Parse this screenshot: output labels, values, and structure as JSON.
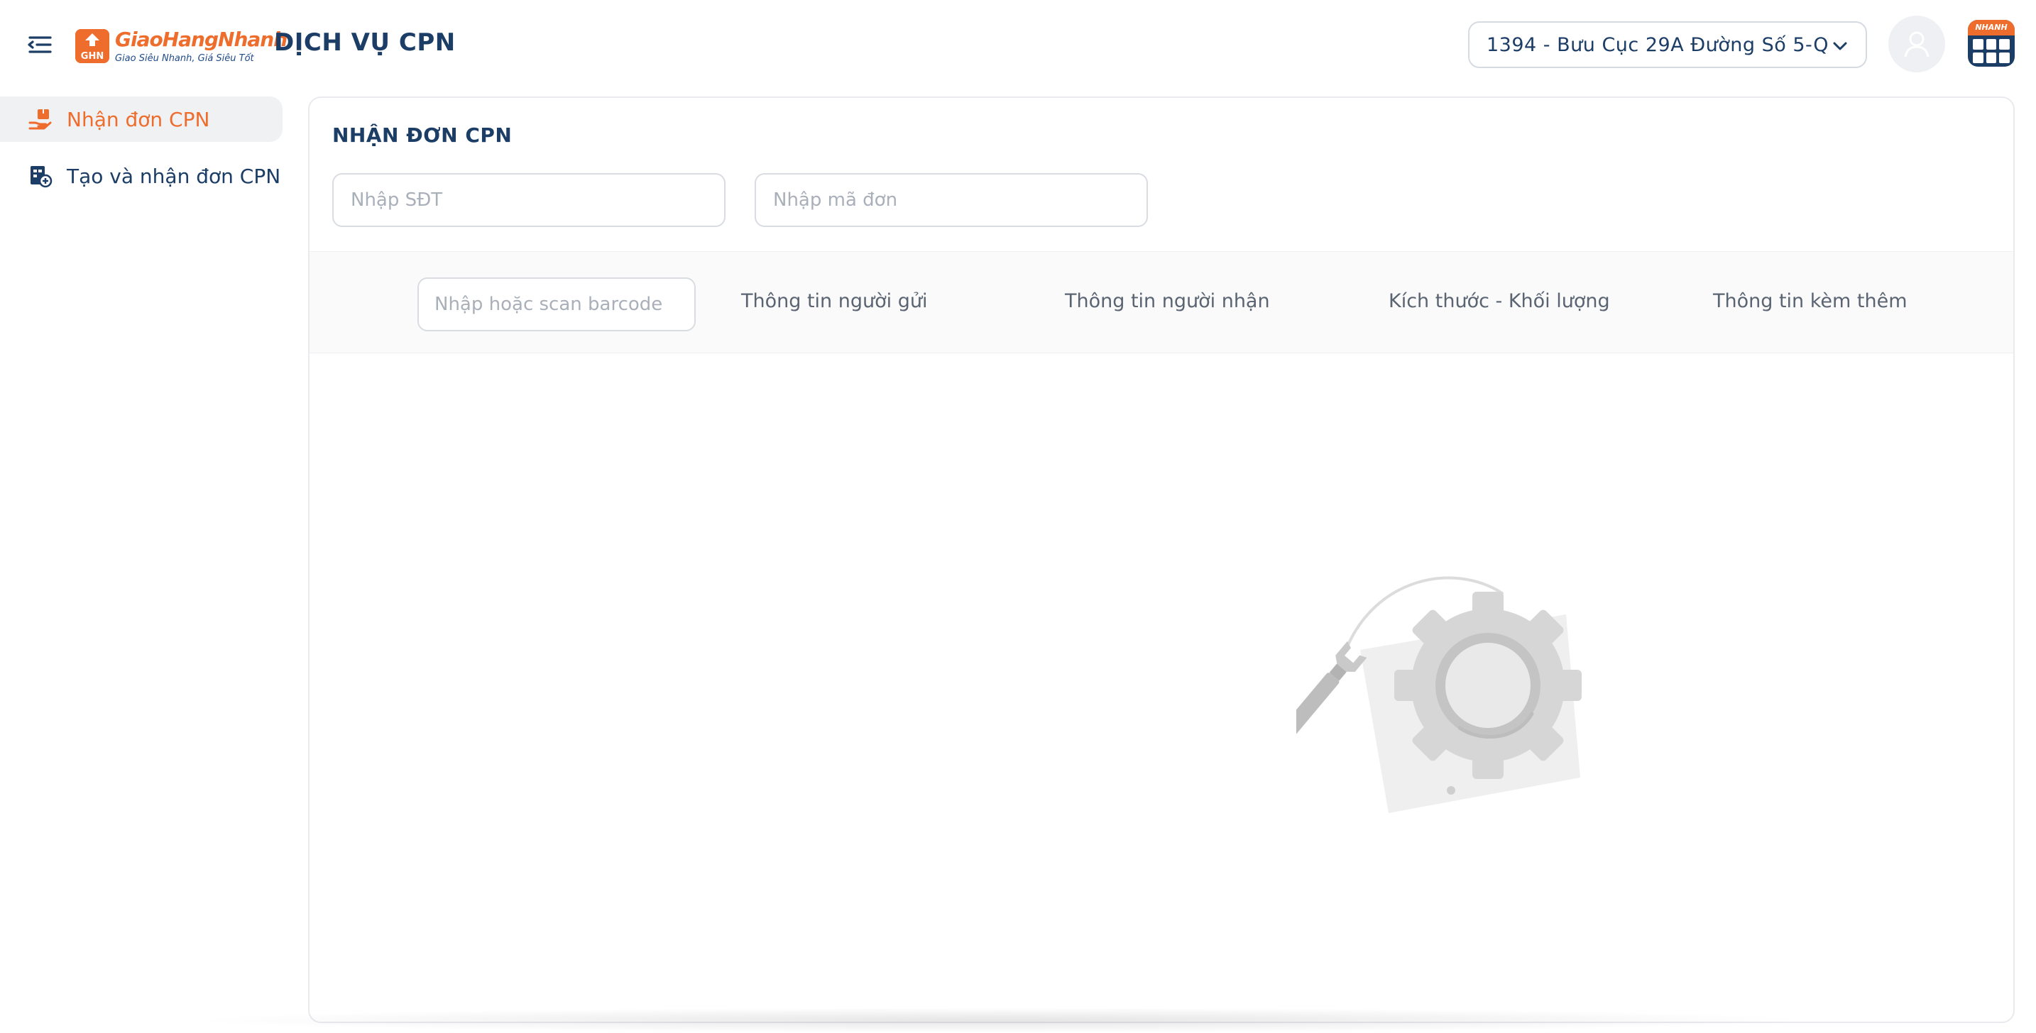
{
  "header": {
    "menu_icon": "menu-fold-icon",
    "logo": {
      "name": "GiaoHangNhanh",
      "mark_text": "GHN",
      "tagline": "Giao Siêu Nhanh, Giá Siêu Tốt",
      "color": "#ee6d2d"
    },
    "app_title": "DỊCH VỤ CPN",
    "branch_select": {
      "value": "1394 - Bưu Cục 29A Đường Số 5-Q....",
      "icon": "chevron-down-icon"
    },
    "avatar_icon": "user-icon",
    "app_launcher": {
      "label": "NHANH",
      "icon": "app-grid-icon"
    }
  },
  "sidebar": {
    "items": [
      {
        "label": "Nhận đơn CPN",
        "icon": "receive-parcel-icon",
        "active": true
      },
      {
        "label": "Tạo và nhận đơn CPN",
        "icon": "create-order-icon",
        "active": false
      }
    ]
  },
  "main": {
    "title": "NHẬN ĐƠN CPN",
    "phone_placeholder": "Nhập SĐT",
    "order_placeholder": "Nhập mã đơn",
    "table": {
      "barcode_placeholder": "Nhập hoặc scan barcode",
      "columns": [
        "Thông tin người gửi",
        "Thông tin người nhận",
        "Kích thước - Khối lượng",
        "Thông tin kèm thêm"
      ]
    },
    "empty_state_icon": "maintenance-gear-wrench-icon"
  },
  "colors": {
    "brand_orange": "#ee6d2d",
    "navy": "#1b3d66",
    "text_muted": "#5a6472"
  }
}
